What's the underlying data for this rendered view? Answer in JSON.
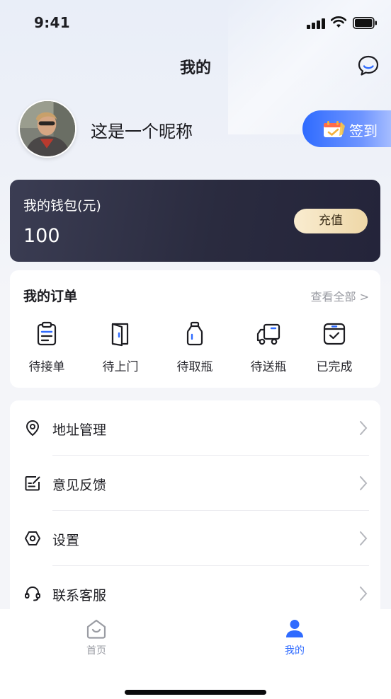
{
  "status_bar": {
    "time": "9:41"
  },
  "header": {
    "title": "我的",
    "message_icon": "chat-bubble-icon"
  },
  "profile": {
    "nickname": "这是一个昵称",
    "checkin_label": "签到",
    "checkin_icon": "calendar-icon",
    "accent": "#2f6bff"
  },
  "wallet": {
    "title": "我的钱包(元)",
    "balance": "100",
    "recharge_label": "充值"
  },
  "orders": {
    "title": "我的订单",
    "view_all": "查看全部 >",
    "items": [
      {
        "label": "待接单",
        "icon": "clipboard-icon"
      },
      {
        "label": "待上门",
        "icon": "door-icon"
      },
      {
        "label": "待取瓶",
        "icon": "bottle-icon"
      },
      {
        "label": "待送瓶",
        "icon": "delivery-truck-icon"
      },
      {
        "label": "已完成",
        "icon": "completed-box-icon"
      }
    ]
  },
  "menu": {
    "items": [
      {
        "label": "地址管理",
        "icon": "location-pin-icon"
      },
      {
        "label": "意见反馈",
        "icon": "feedback-edit-icon"
      },
      {
        "label": "设置",
        "icon": "settings-hexagon-icon"
      },
      {
        "label": "联系客服",
        "icon": "headset-icon"
      }
    ]
  },
  "tabbar": {
    "tabs": [
      {
        "label": "首页",
        "icon": "home-icon",
        "active": false
      },
      {
        "label": "我的",
        "icon": "user-icon",
        "active": true
      }
    ],
    "active_color": "#2f6bff",
    "inactive_color": "#9a9ca3"
  }
}
